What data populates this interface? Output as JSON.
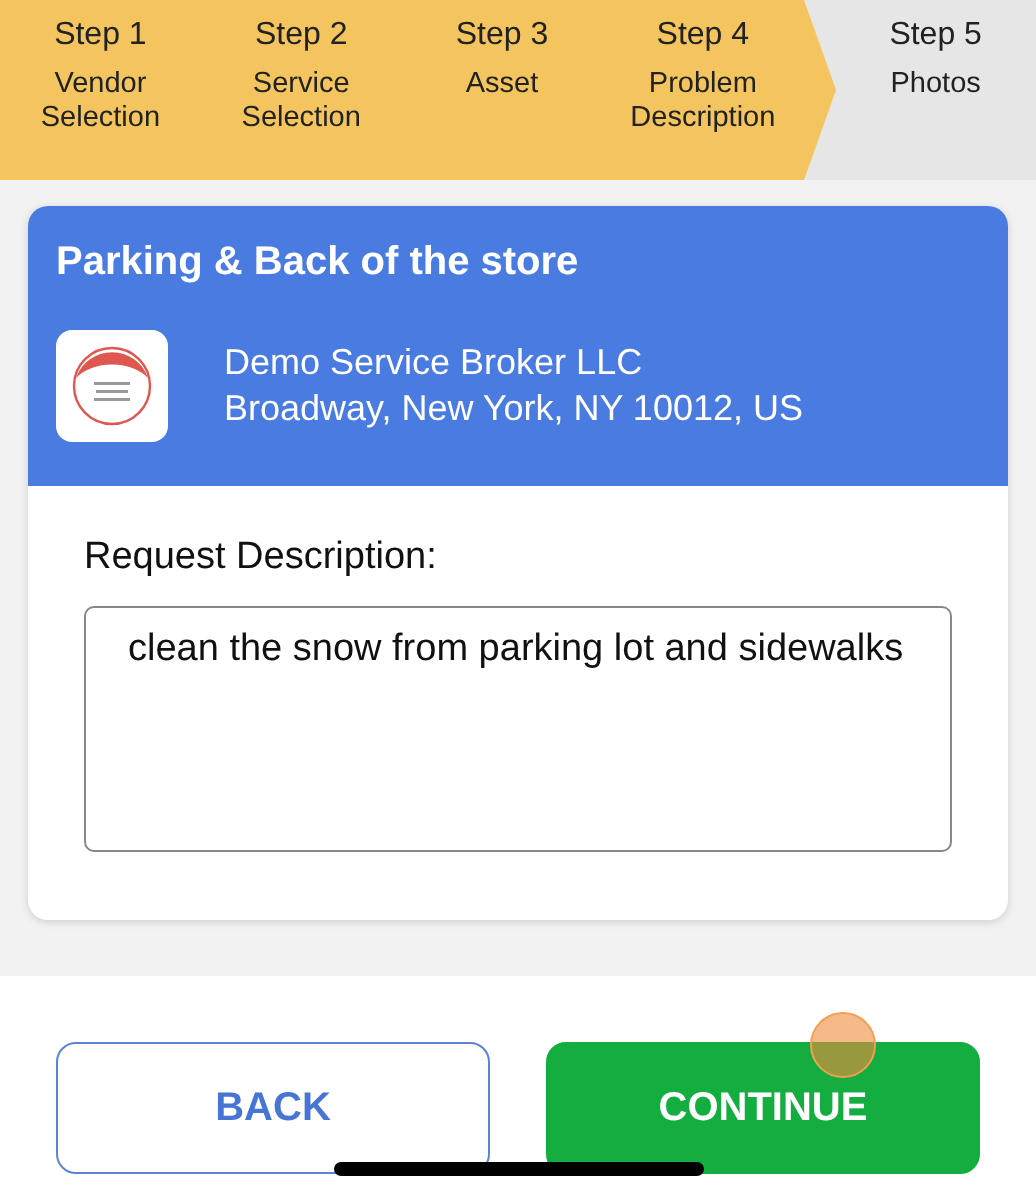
{
  "steps": [
    {
      "number": "Step 1",
      "label": "Vendor Selection",
      "completed": true
    },
    {
      "number": "Step 2",
      "label": "Service Selection",
      "completed": true
    },
    {
      "number": "Step 3",
      "label": "Asset",
      "completed": true
    },
    {
      "number": "Step 4",
      "label": "Problem Description",
      "completed": true
    },
    {
      "number": "Step 5",
      "label": "Photos",
      "completed": false
    }
  ],
  "location": {
    "title": "Parking & Back of the store",
    "vendor": "Demo Service Broker LLC",
    "address": "Broadway, New York, NY 10012, US"
  },
  "request": {
    "label": "Request Description:",
    "value": "clean the snow from parking lot and sidewalks"
  },
  "buttons": [
    {
      "label": "BACK",
      "kind": "secondary"
    },
    {
      "label": "CONTINUE",
      "kind": "primary"
    }
  ]
}
